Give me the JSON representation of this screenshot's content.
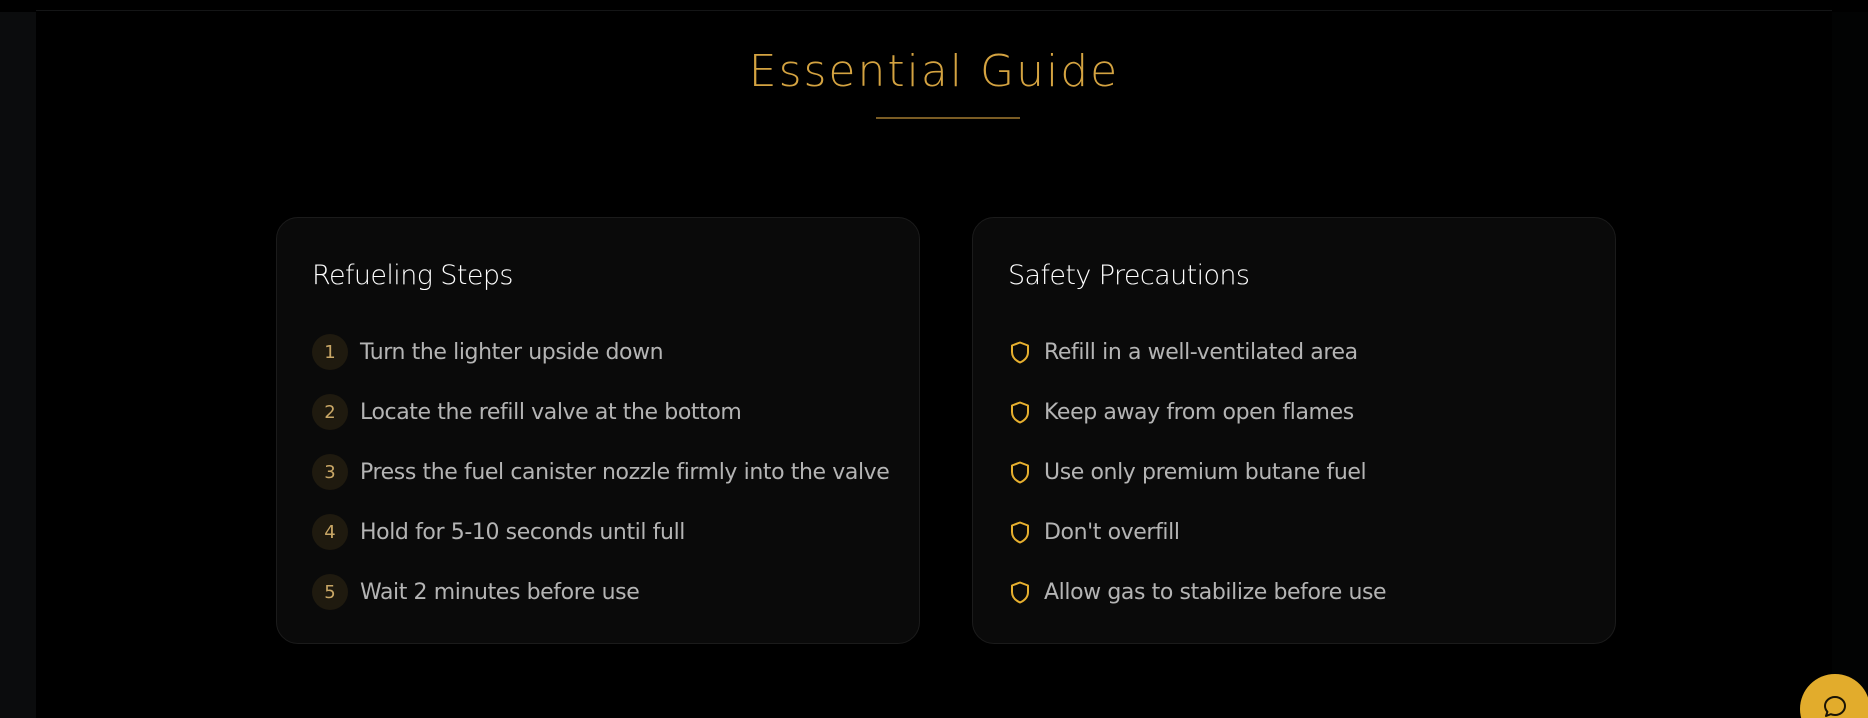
{
  "section": {
    "title": "Essential Guide"
  },
  "refueling": {
    "title": "Refueling Steps",
    "steps": [
      {
        "num": "1",
        "text": "Turn the lighter upside down"
      },
      {
        "num": "2",
        "text": "Locate the refill valve at the bottom"
      },
      {
        "num": "3",
        "text": "Press the fuel canister nozzle firmly into the valve"
      },
      {
        "num": "4",
        "text": "Hold for 5-10 seconds until full"
      },
      {
        "num": "5",
        "text": "Wait 2 minutes before use"
      }
    ]
  },
  "safety": {
    "title": "Safety Precautions",
    "icon": "shield-icon",
    "items": [
      {
        "text": "Refill in a well-ventilated area"
      },
      {
        "text": "Keep away from open flames"
      },
      {
        "text": "Use only premium butane fuel"
      },
      {
        "text": "Don't overfill"
      },
      {
        "text": "Allow gas to stabilize before use"
      }
    ]
  },
  "chat": {
    "icon": "chat-bubble-icon"
  },
  "colors": {
    "accent": "#d4a341",
    "shield": "#e7b02f",
    "chat_button": "#e2ac2c",
    "background": "#000000",
    "card": "#0a0a0a"
  }
}
